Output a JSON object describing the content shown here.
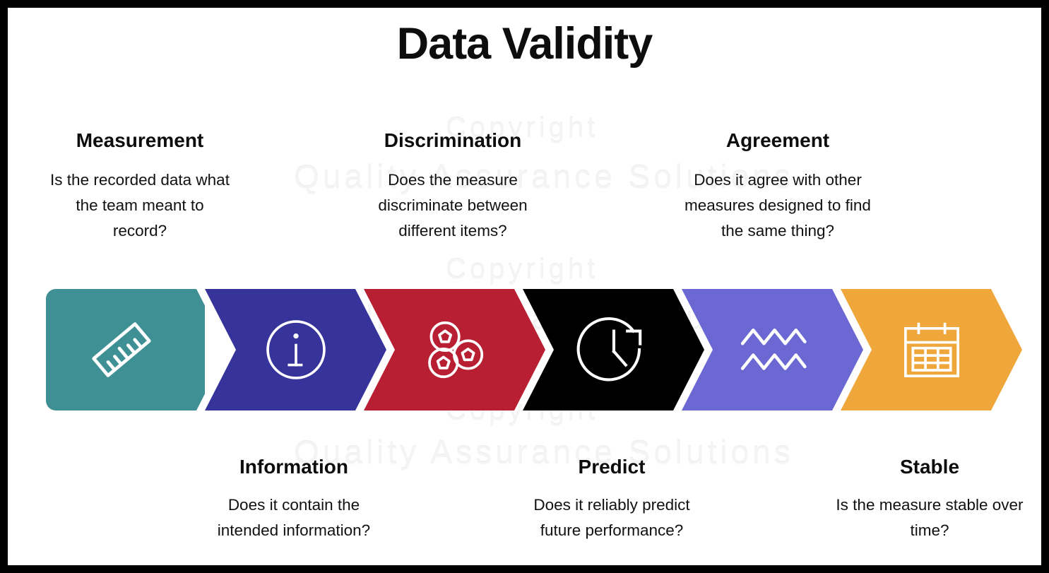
{
  "title": "Data Validity",
  "watermark": {
    "line_a": "Copyright",
    "line_b": "Quality Assurance Solutions"
  },
  "colors": {
    "border": "#000000",
    "background": "#ffffff",
    "text": "#0d0d0d",
    "teal": "#3E9094",
    "indigo": "#36339B",
    "crimson": "#B91F33",
    "black": "#000000",
    "periwinkle": "#6B68D4",
    "orange": "#EFA73C",
    "icon": "#ffffff"
  },
  "steps": [
    {
      "id": "measurement",
      "label": "Measurement",
      "question": "Is the recorded data what the team meant to record?",
      "icon": "ruler-icon",
      "color": "#3E9094",
      "position": "top"
    },
    {
      "id": "information",
      "label": "Information",
      "question": "Does it contain the intended information?",
      "icon": "info-circle-icon",
      "color": "#36339B",
      "position": "bottom"
    },
    {
      "id": "discrimination",
      "label": "Discrimination",
      "question": "Does the measure discriminate between different items?",
      "icon": "berries-icon",
      "color": "#B91F33",
      "position": "top"
    },
    {
      "id": "predict",
      "label": "Predict",
      "question": "Does it reliably predict future performance?",
      "icon": "clock-forecast-icon",
      "color": "#000000",
      "position": "bottom"
    },
    {
      "id": "agreement",
      "label": "Agreement",
      "question": "Does it agree with other measures designed to find the same thing?",
      "icon": "zigzag-waves-icon",
      "color": "#6B68D4",
      "position": "top"
    },
    {
      "id": "stable",
      "label": "Stable",
      "question": "Is the measure stable over time?",
      "icon": "calendar-icon",
      "color": "#EFA73C",
      "position": "bottom"
    }
  ],
  "callouts": {
    "top": [
      {
        "title": "Measurement",
        "line1": "Is the recorded data what",
        "line2": "the team meant to",
        "line3": "record?"
      },
      {
        "title": "Discrimination",
        "line1": "Does the measure",
        "line2": "discriminate between",
        "line3": "different items?"
      },
      {
        "title": "Agreement",
        "line1": "Does it agree with other",
        "line2": "measures designed to find",
        "line3": "the same thing?"
      }
    ],
    "bottom": [
      {
        "title": "Information",
        "line1": "Does it contain the",
        "line2": "intended information?",
        "line3": ""
      },
      {
        "title": "Predict",
        "line1": "Does it reliably predict",
        "line2": "future performance?",
        "line3": ""
      },
      {
        "title": "Stable",
        "line1": "Is the measure stable over",
        "line2": "time?",
        "line3": ""
      }
    ]
  }
}
